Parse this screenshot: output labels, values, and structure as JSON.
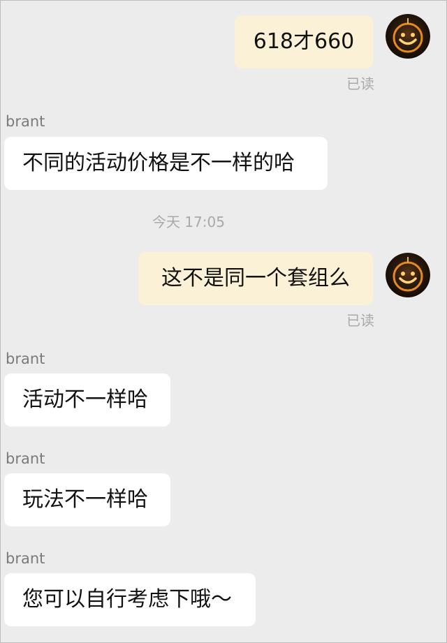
{
  "messages": [
    {
      "text": "618才660",
      "read_label": "已读"
    },
    {
      "sender": "brant",
      "text": "不同的活动价格是不一样的哈"
    },
    {
      "timestamp": "今天 17:05"
    },
    {
      "text": "这不是同一个套组么",
      "read_label": "已读"
    },
    {
      "sender": "brant",
      "text": "活动不一样哈"
    },
    {
      "sender": "brant",
      "text": "玩法不一样哈"
    },
    {
      "sender": "brant",
      "text": "您可以自行考虑下哦～"
    }
  ],
  "icons": {
    "self_avatar": "smiley-face-avatar"
  },
  "colors": {
    "background": "#ececec",
    "outgoing_bubble": "#fbf1d6",
    "incoming_bubble": "#ffffff",
    "meta_text": "#a9a9a9"
  }
}
